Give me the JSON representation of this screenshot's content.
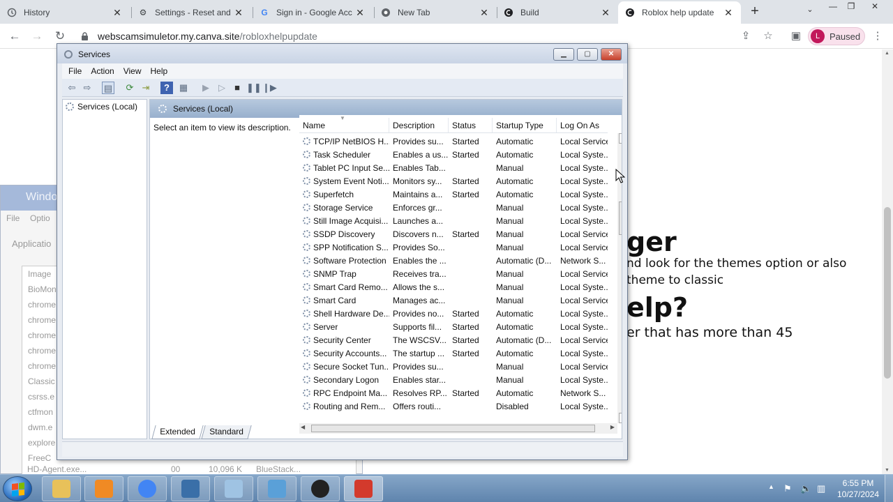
{
  "browser": {
    "tabs": [
      {
        "title": "History",
        "icon": "history-icon"
      },
      {
        "title": "Settings - Reset and",
        "icon": "gear-icon"
      },
      {
        "title": "Sign in - Google Acc",
        "icon": "google-icon"
      },
      {
        "title": "New Tab",
        "icon": "chrome-icon"
      },
      {
        "title": "Build",
        "icon": "site-icon"
      },
      {
        "title": "Roblox help update",
        "icon": "site-icon"
      }
    ],
    "url_host": "webscamsimuletor.my.canva.site",
    "url_path": "/robloxhelpupdate",
    "profile_initial": "L",
    "profile_status": "Paused"
  },
  "webpage": {
    "heading1": "ger",
    "text1": "nd look for the themes option or also",
    "text2": "theme to classic",
    "heading2": "elp?",
    "text3": "er that has more than 45"
  },
  "ghost_window": {
    "title": "Windo",
    "menu": [
      "File",
      "Optio"
    ],
    "tab": "Applicatio",
    "column": "Image",
    "items": [
      "BioMon",
      "chrome",
      "chrome",
      "chrome",
      "chrome",
      "chrome",
      "Classic",
      "csrss.e",
      "ctfmon",
      "dwm.e",
      "explore",
      "FreeC"
    ],
    "footer": [
      "HD-Agent.exe...",
      "00",
      "10,096 K",
      "BlueStack..."
    ]
  },
  "services": {
    "title": "Services",
    "menu": [
      "File",
      "Action",
      "View",
      "Help"
    ],
    "tree_node": "Services (Local)",
    "panel_title": "Services (Local)",
    "description_hint": "Select an item to view its description.",
    "columns": [
      "Name",
      "Description",
      "Status",
      "Startup Type",
      "Log On As"
    ],
    "rows": [
      {
        "name": "TCP/IP NetBIOS H...",
        "description": "Provides su...",
        "status": "Started",
        "startup": "Automatic",
        "logon": "Local Service"
      },
      {
        "name": "Task Scheduler",
        "description": "Enables a us...",
        "status": "Started",
        "startup": "Automatic",
        "logon": "Local Syste..."
      },
      {
        "name": "Tablet PC Input Se...",
        "description": "Enables Tab...",
        "status": "",
        "startup": "Manual",
        "logon": "Local Syste..."
      },
      {
        "name": "System Event Noti...",
        "description": "Monitors sy...",
        "status": "Started",
        "startup": "Automatic",
        "logon": "Local Syste..."
      },
      {
        "name": "Superfetch",
        "description": "Maintains a...",
        "status": "Started",
        "startup": "Automatic",
        "logon": "Local Syste..."
      },
      {
        "name": "Storage Service",
        "description": "Enforces gr...",
        "status": "",
        "startup": "Manual",
        "logon": "Local Syste..."
      },
      {
        "name": "Still Image Acquisi...",
        "description": "Launches a...",
        "status": "",
        "startup": "Manual",
        "logon": "Local Syste..."
      },
      {
        "name": "SSDP Discovery",
        "description": "Discovers n...",
        "status": "Started",
        "startup": "Manual",
        "logon": "Local Service"
      },
      {
        "name": "SPP Notification S...",
        "description": "Provides So...",
        "status": "",
        "startup": "Manual",
        "logon": "Local Service"
      },
      {
        "name": "Software Protection",
        "description": "Enables the ...",
        "status": "",
        "startup": "Automatic (D...",
        "logon": "Network S..."
      },
      {
        "name": "SNMP Trap",
        "description": "Receives tra...",
        "status": "",
        "startup": "Manual",
        "logon": "Local Service"
      },
      {
        "name": "Smart Card Remo...",
        "description": "Allows the s...",
        "status": "",
        "startup": "Manual",
        "logon": "Local Syste..."
      },
      {
        "name": "Smart Card",
        "description": "Manages ac...",
        "status": "",
        "startup": "Manual",
        "logon": "Local Service"
      },
      {
        "name": "Shell Hardware De...",
        "description": "Provides no...",
        "status": "Started",
        "startup": "Automatic",
        "logon": "Local Syste..."
      },
      {
        "name": "Server",
        "description": "Supports fil...",
        "status": "Started",
        "startup": "Automatic",
        "logon": "Local Syste..."
      },
      {
        "name": "Security Center",
        "description": "The WSCSV...",
        "status": "Started",
        "startup": "Automatic (D...",
        "logon": "Local Service"
      },
      {
        "name": "Security Accounts...",
        "description": "The startup ...",
        "status": "Started",
        "startup": "Automatic",
        "logon": "Local Syste..."
      },
      {
        "name": "Secure Socket Tun...",
        "description": "Provides su...",
        "status": "",
        "startup": "Manual",
        "logon": "Local Service"
      },
      {
        "name": "Secondary Logon",
        "description": "Enables star...",
        "status": "",
        "startup": "Manual",
        "logon": "Local Syste..."
      },
      {
        "name": "RPC Endpoint Ma...",
        "description": "Resolves RP...",
        "status": "Started",
        "startup": "Automatic",
        "logon": "Network S..."
      },
      {
        "name": "Routing and Rem...",
        "description": "Offers routi...",
        "status": "",
        "startup": "Disabled",
        "logon": "Local Syste..."
      }
    ],
    "view_tabs": [
      "Extended",
      "Standard"
    ]
  },
  "taskbar": {
    "apps": [
      {
        "name": "explorer",
        "color": "#e8c15a"
      },
      {
        "name": "media-player",
        "color": "#f08a24"
      },
      {
        "name": "chrome",
        "color": "#4285f4"
      },
      {
        "name": "remote-desktop",
        "color": "#3a6fa8"
      },
      {
        "name": "notepad",
        "color": "#9fc3e3"
      },
      {
        "name": "mail",
        "color": "#5aa0d8"
      },
      {
        "name": "obs",
        "color": "#222222"
      },
      {
        "name": "toolbox",
        "color": "#d33a2c"
      }
    ],
    "time": "6:55 PM",
    "date": "10/27/2024"
  },
  "colors": {
    "tabbar": "#dfe3e8",
    "services_header": "#98b0cd",
    "taskbar": "#5f84ad"
  }
}
